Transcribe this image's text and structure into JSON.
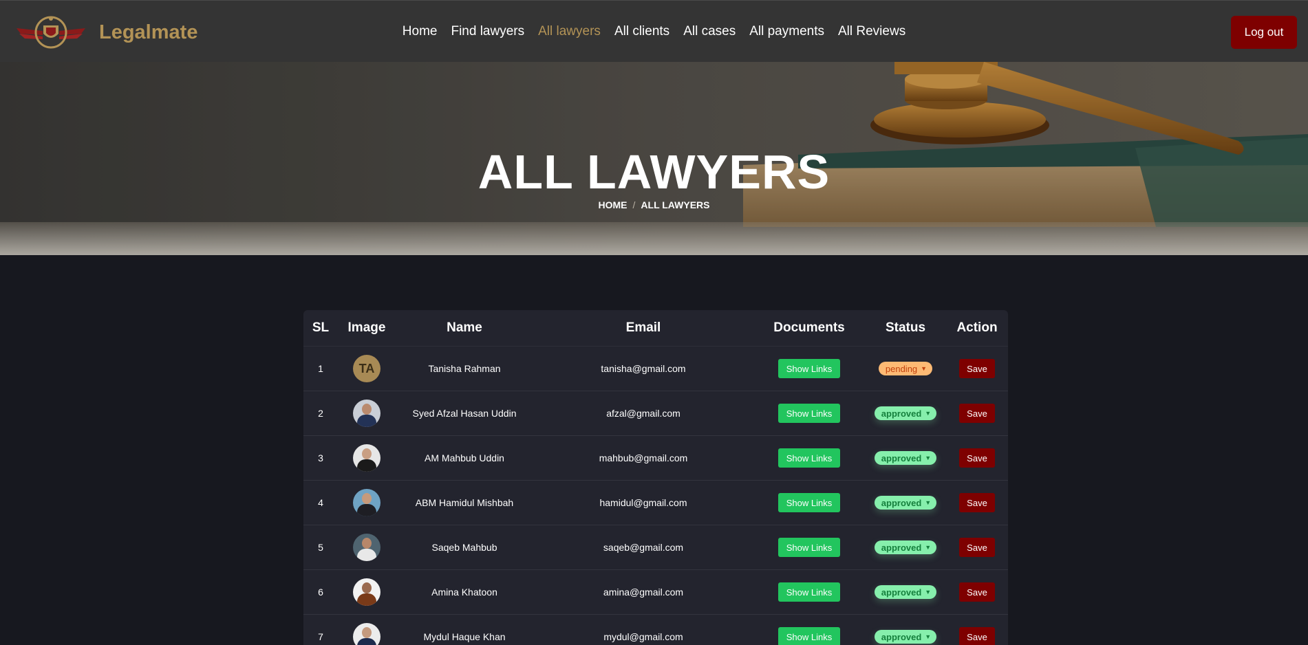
{
  "navbar": {
    "brand_name": "Legalmate",
    "links": [
      "Home",
      "Find lawyers",
      "All lawyers",
      "All clients",
      "All cases",
      "All payments",
      "All Reviews"
    ],
    "active_link": "All lawyers",
    "logout_label": "Log out"
  },
  "hero": {
    "title": "ALL LAWYERS",
    "breadcrumb_home": "HOME",
    "breadcrumb_sep": "/",
    "breadcrumb_current": "ALL LAWYERS"
  },
  "table": {
    "headers": {
      "sl": "SL",
      "image": "Image",
      "name": "Name",
      "email": "Email",
      "documents": "Documents",
      "status": "Status",
      "action": "Action"
    },
    "docs_label": "Show Links",
    "save_label": "Save",
    "rows": [
      {
        "sl": "1",
        "initials": "TA",
        "name": "Tanisha Rahman",
        "email": "tanisha@gmail.com",
        "status": "pending"
      },
      {
        "sl": "2",
        "initials": "",
        "name": "Syed Afzal Hasan Uddin",
        "email": "afzal@gmail.com",
        "status": "approved"
      },
      {
        "sl": "3",
        "initials": "",
        "name": "AM Mahbub Uddin",
        "email": "mahbub@gmail.com",
        "status": "approved"
      },
      {
        "sl": "4",
        "initials": "",
        "name": "ABM Hamidul Mishbah",
        "email": "hamidul@gmail.com",
        "status": "approved"
      },
      {
        "sl": "5",
        "initials": "",
        "name": "Saqeb Mahbub",
        "email": "saqeb@gmail.com",
        "status": "approved"
      },
      {
        "sl": "6",
        "initials": "",
        "name": "Amina Khatoon",
        "email": "amina@gmail.com",
        "status": "approved"
      },
      {
        "sl": "7",
        "initials": "",
        "name": "Mydul Haque Khan",
        "email": "mydul@gmail.com",
        "status": "approved"
      }
    ]
  },
  "colors": {
    "brand_gold": "#b39356",
    "logout_red": "#7e0000",
    "show_links_green": "#22c55e",
    "pending_bg": "#fdba74",
    "approved_bg": "#86efac"
  }
}
